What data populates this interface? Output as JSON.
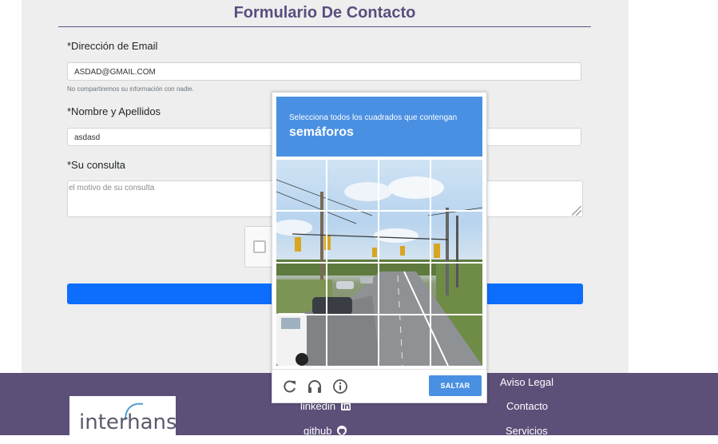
{
  "form": {
    "title": "Formulario De Contacto",
    "email_label": "*Dirección de Email",
    "email_value": "ASDAD@GMAIL.COM",
    "email_help": "No compartiremos su información con nadie.",
    "name_label": "*Nombre y Apellidos",
    "name_value": "asdasd",
    "query_label": "*Su consulta",
    "query_placeholder": "el motivo de su consulta"
  },
  "captcha": {
    "instruction": "Selecciona todos los cuadrados que contengan",
    "target": "semáforos",
    "skip_label": "SALTAR",
    "icons": [
      "reload-icon",
      "audio-icon",
      "info-icon"
    ]
  },
  "footer": {
    "logo_text": "interhanse",
    "links_center": [
      {
        "label": "linkedin",
        "icon": "linkedin-icon"
      },
      {
        "label": "github",
        "icon": "github-icon"
      }
    ],
    "links_right": [
      "Aviso Legal",
      "Contacto",
      "Servicios"
    ]
  },
  "colors": {
    "title": "#5b4e7e",
    "primary_button": "#0d6efd",
    "captcha_blue": "#4a90e2",
    "footer": "#5c5079"
  }
}
